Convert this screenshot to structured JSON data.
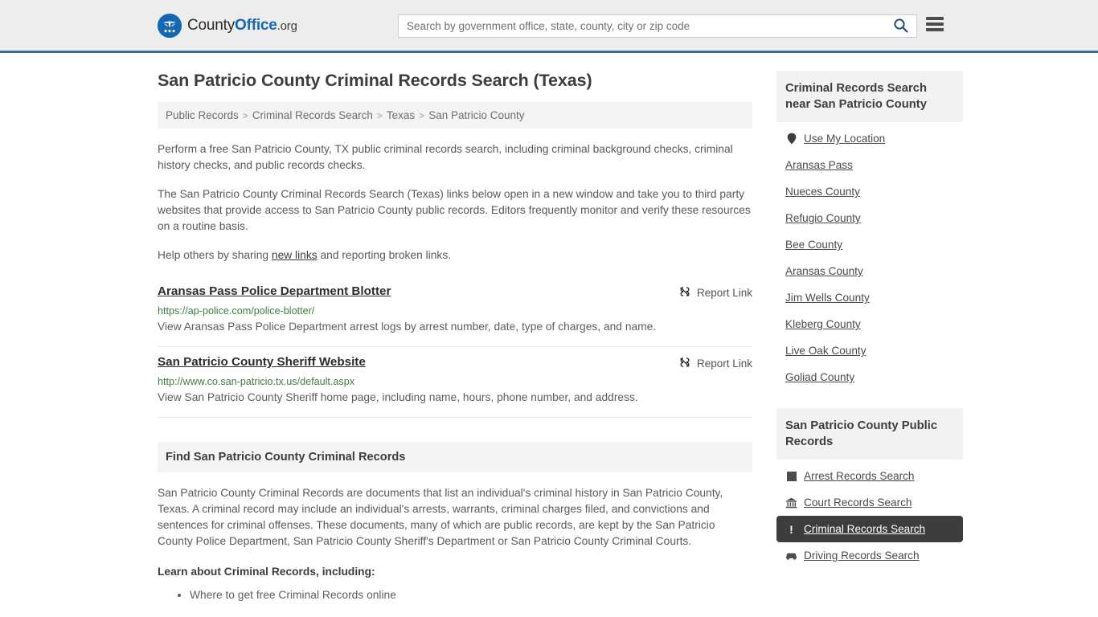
{
  "header": {
    "logo_text_part1": "County",
    "logo_text_part2": "Office",
    "logo_text_part3": ".org",
    "logo_icon": "eagle-stars-seal-icon",
    "search_placeholder": "Search by government office, state, county, city or zip code",
    "search_value": "",
    "search_icon": "search-icon",
    "menu_icon": "hamburger-menu-icon",
    "accent_color": "#336b9e",
    "logo_blue": "#1567b2"
  },
  "page": {
    "title": "San Patricio County Criminal Records Search (Texas)"
  },
  "breadcrumb": {
    "separator": ">",
    "items": [
      {
        "label": "Public Records"
      },
      {
        "label": "Criminal Records Search"
      },
      {
        "label": "Texas"
      },
      {
        "label": "San Patricio County"
      }
    ]
  },
  "intro": {
    "paragraph1": "Perform a free San Patricio County, TX public criminal records search, including criminal background checks, criminal history checks, and public records checks.",
    "paragraph2": "The San Patricio County Criminal Records Search (Texas) links below open in a new window and take you to third party websites that provide access to San Patricio County public records. Editors frequently monitor and verify these resources on a routine basis.",
    "paragraph3_before": "Help others by sharing ",
    "paragraph3_link": "new links",
    "paragraph3_after": " and reporting broken links."
  },
  "results": {
    "report_label": "Report Link",
    "report_icon": "broken-link-icon",
    "items": [
      {
        "title": "Aransas Pass Police Department Blotter",
        "url": "https://ap-police.com/police-blotter/",
        "description": "View Aransas Pass Police Department arrest logs by arrest number, date, type of charges, and name."
      },
      {
        "title": "San Patricio County Sheriff Website",
        "url": "http://www.co.san-patricio.tx.us/default.aspx",
        "description": "View San Patricio County Sheriff home page, including name, hours, phone number, and address."
      }
    ]
  },
  "find_section": {
    "heading": "Find San Patricio County Criminal Records",
    "paragraph": "San Patricio County Criminal Records are documents that list an individual's criminal history in San Patricio County, Texas. A criminal record may include an individual's arrests, warrants, criminal charges filed, and convictions and sentences for criminal offenses. These documents, many of which are public records, are kept by the San Patricio County Police Department, San Patricio County Sheriff's Department or San Patricio County Criminal Courts.",
    "learn_heading": "Learn about Criminal Records, including:",
    "bullets": [
      "Where to get free Criminal Records online"
    ]
  },
  "sidebar": {
    "nearby": {
      "heading": "Criminal Records Search near San Patricio County",
      "use_my_location": {
        "label": "Use My Location",
        "icon": "map-pin-icon"
      },
      "items": [
        {
          "label": "Aransas Pass"
        },
        {
          "label": "Nueces County"
        },
        {
          "label": "Refugio County"
        },
        {
          "label": "Bee County"
        },
        {
          "label": "Aransas County"
        },
        {
          "label": "Jim Wells County"
        },
        {
          "label": "Kleberg County"
        },
        {
          "label": "Live Oak County"
        },
        {
          "label": "Goliad County"
        }
      ]
    },
    "public_records": {
      "heading": "San Patricio County Public Records",
      "items": [
        {
          "label": "Arrest Records Search",
          "icon": "square-icon",
          "active": false
        },
        {
          "label": "Court Records Search",
          "icon": "courthouse-icon",
          "active": false
        },
        {
          "label": "Criminal Records Search",
          "icon": "exclamation-icon",
          "active": true
        },
        {
          "label": "Driving Records Search",
          "icon": "car-icon",
          "active": false
        }
      ],
      "active_bg_color": "#3d3d3d"
    }
  }
}
